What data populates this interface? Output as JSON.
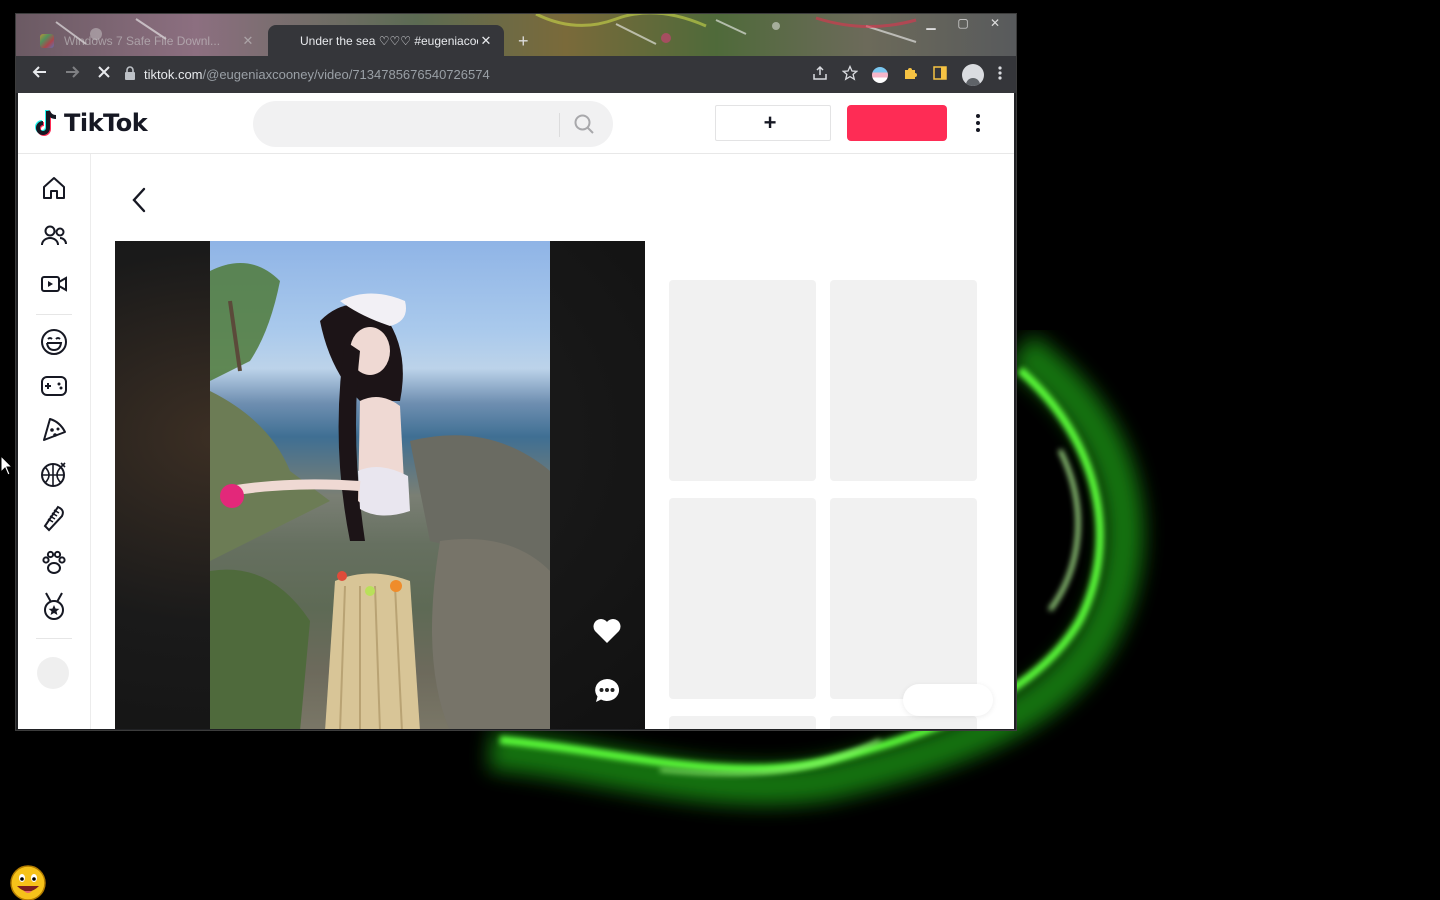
{
  "browser": {
    "tabs": [
      {
        "title": "Windows 7 Safe File Downl...",
        "active": false
      },
      {
        "title": "Under the sea ♡♡♡ #eugeniacooney",
        "active": true
      }
    ],
    "new_tab_label": "+",
    "url_host": "tiktok.com",
    "url_path": "/@eugeniaxcooney/video/7134785676540726574"
  },
  "tiktok": {
    "brand": "TikTok",
    "search_placeholder": "",
    "upload_label": "",
    "login_label": "",
    "brand_color": "#fe2c55",
    "sidebar_icons": [
      "home-icon",
      "following-icon",
      "live-icon",
      "comedy-icon",
      "gaming-icon",
      "food-icon",
      "sports-icon",
      "beauty-icon",
      "animals-icon",
      "achievement-icon"
    ],
    "video_actions": [
      "like-icon",
      "comment-icon"
    ]
  }
}
